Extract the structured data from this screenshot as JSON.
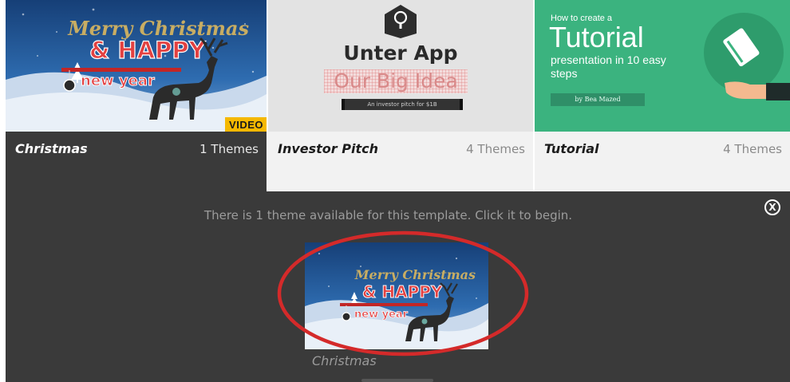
{
  "templates": [
    {
      "name": "Christmas",
      "count": "1 Themes",
      "badge": "VIDEO",
      "art": {
        "script": "Merry Christmas",
        "happy": "& HAPPY",
        "new_year": "new year"
      }
    },
    {
      "name": "Investor Pitch",
      "count": "4 Themes",
      "art": {
        "title": "Unter App",
        "subtitle": "Our Big Idea",
        "tagline": "An investor pitch for $1B"
      }
    },
    {
      "name": "Tutorial",
      "count": "4 Themes",
      "art": {
        "kicker": "How to create a",
        "title": "Tutorial",
        "subtitle": "presentation in 10 easy steps",
        "byline": "by Bea Mazed"
      }
    }
  ],
  "panel": {
    "message": "There is 1 theme available for this template. Click it to begin.",
    "close_label": "X",
    "theme": {
      "caption": "Christmas",
      "art": {
        "script": "Merry Christmas",
        "happy": "& HAPPY",
        "new_year": "new year"
      }
    }
  },
  "colors": {
    "dark_panel": "#3a3a3a",
    "light_meta": "#f2f2f2",
    "tutorial_green": "#3bb37f",
    "christmas_sky": "#1c4b86",
    "video_badge": "#f5b800",
    "highlight_ring": "#d42a2a"
  },
  "icons": {
    "investor_logo": "location-pin-icon",
    "tutorial_illustration": "book-in-hand-icon",
    "close": "close-circle-icon"
  }
}
